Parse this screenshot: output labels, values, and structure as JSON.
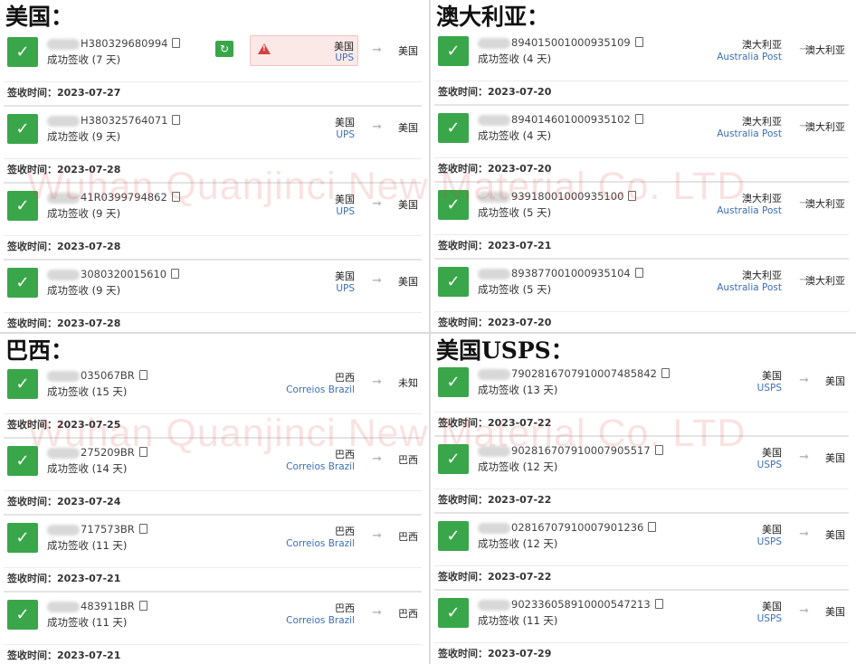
{
  "watermark": "Wuhan Quanjinci New Material Co. LTD",
  "check_color": "#3aa64a",
  "carrier_color": "#3b6fb5",
  "date_label": "签收时间：",
  "sections": [
    {
      "heading": "美国：",
      "cards": [
        {
          "tracking": "H380329680994",
          "status": "成功签收 (7 天)",
          "origin": "美国",
          "carrier": "UPS",
          "dest": "美国",
          "date": "2023-07-27",
          "alert": true
        },
        {
          "tracking": "H380325764071",
          "status": "成功签收 (9 天)",
          "origin": "美国",
          "carrier": "UPS",
          "dest": "美国",
          "date": "2023-07-28"
        },
        {
          "tracking": "41R0399794862",
          "status": "成功签收 (9 天)",
          "origin": "美国",
          "carrier": "UPS",
          "dest": "美国",
          "date": "2023-07-28"
        },
        {
          "tracking": "3080320015610",
          "status": "成功签收 (9 天)",
          "origin": "美国",
          "carrier": "UPS",
          "dest": "美国",
          "date": "2023-07-28"
        }
      ]
    },
    {
      "heading": "澳大利亚：",
      "cards": [
        {
          "tracking": "894015001000935109",
          "status": "成功签收 (4 天)",
          "origin": "澳大利亚",
          "carrier": "Australia Post",
          "dest": "澳大利亚",
          "date": "2023-07-20"
        },
        {
          "tracking": "894014601000935102",
          "status": "成功签收 (4 天)",
          "origin": "澳大利亚",
          "carrier": "Australia Post",
          "dest": "澳大利亚",
          "date": "2023-07-20"
        },
        {
          "tracking": "93918001000935100",
          "status": "成功签收 (5 天)",
          "origin": "澳大利亚",
          "carrier": "Australia Post",
          "dest": "澳大利亚",
          "date": "2023-07-21"
        },
        {
          "tracking": "893877001000935104",
          "status": "成功签收 (5 天)",
          "origin": "澳大利亚",
          "carrier": "Australia Post",
          "dest": "澳大利亚",
          "date": "2023-07-20"
        }
      ]
    },
    {
      "heading": "巴西：",
      "cards": [
        {
          "tracking": "035067BR",
          "status": "成功签收 (15 天)",
          "origin": "巴西",
          "carrier": "Correios Brazil",
          "dest": "未知",
          "date": "2023-07-25"
        },
        {
          "tracking": "275209BR",
          "status": "成功签收 (14 天)",
          "origin": "巴西",
          "carrier": "Correios Brazil",
          "dest": "巴西",
          "date": "2023-07-24"
        },
        {
          "tracking": "717573BR",
          "status": "成功签收 (11 天)",
          "origin": "巴西",
          "carrier": "Correios Brazil",
          "dest": "巴西",
          "date": "2023-07-21"
        },
        {
          "tracking": "483911BR",
          "status": "成功签收 (11 天)",
          "origin": "巴西",
          "carrier": "Correios Brazil",
          "dest": "巴西",
          "date": "2023-07-21"
        }
      ]
    },
    {
      "heading": "美国USPS：",
      "cards": [
        {
          "tracking": "7902816707910007485842",
          "status": "成功签收 (13 天)",
          "origin": "美国",
          "carrier": "USPS",
          "dest": "美国",
          "date": "2023-07-22"
        },
        {
          "tracking": "902816707910007905517",
          "status": "成功签收 (12 天)",
          "origin": "美国",
          "carrier": "USPS",
          "dest": "美国",
          "date": "2023-07-22"
        },
        {
          "tracking": "02816707910007901236",
          "status": "成功签收 (12 天)",
          "origin": "美国",
          "carrier": "USPS",
          "dest": "美国",
          "date": "2023-07-22"
        },
        {
          "tracking": "902336058910000547213",
          "status": "成功签收 (11 天)",
          "origin": "美国",
          "carrier": "USPS",
          "dest": "美国",
          "date": "2023-07-29"
        }
      ]
    }
  ]
}
